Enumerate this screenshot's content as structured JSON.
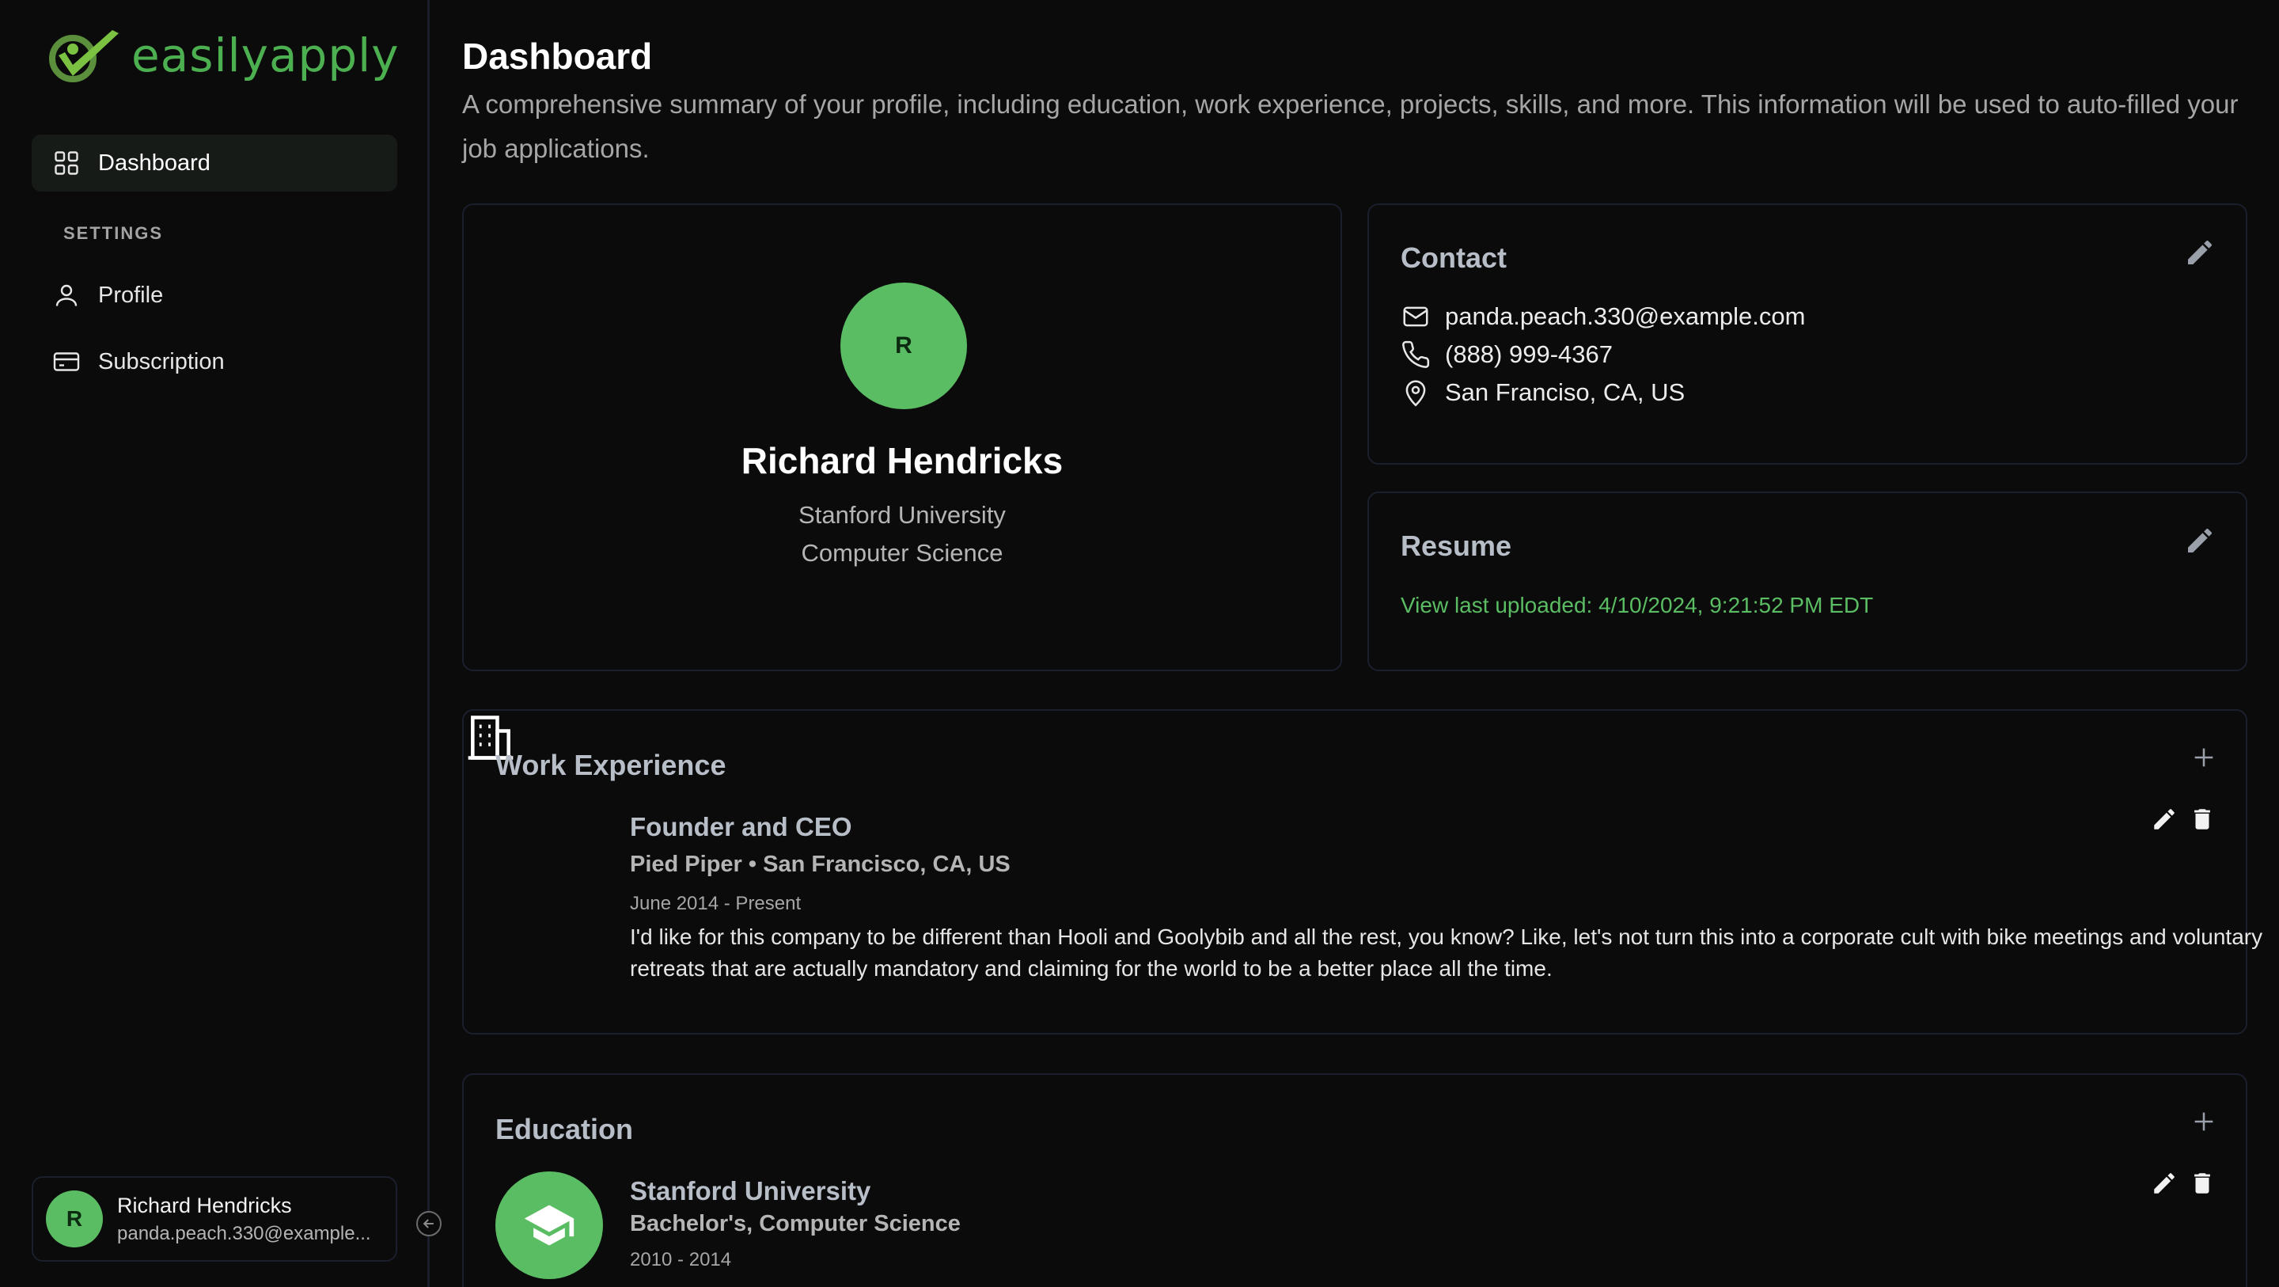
{
  "brand": {
    "name": "easilyapply",
    "accent": "#5bbd63"
  },
  "sidebar": {
    "nav": [
      {
        "label": "Dashboard",
        "icon": "dashboard-icon",
        "active": true
      }
    ],
    "settings_label": "SETTINGS",
    "settings_items": [
      {
        "label": "Profile",
        "icon": "user-icon"
      },
      {
        "label": "Subscription",
        "icon": "credit-card-icon"
      }
    ],
    "user": {
      "initial": "R",
      "name": "Richard Hendricks",
      "email": "panda.peach.330@example..."
    }
  },
  "header": {
    "title": "Dashboard",
    "description": "A comprehensive summary of your profile, including education, work experience, projects, skills, and more. This information will be used to auto-filled your job applications."
  },
  "profile": {
    "initial": "R",
    "name": "Richard Hendricks",
    "school": "Stanford University",
    "major": "Computer Science"
  },
  "contact": {
    "title": "Contact",
    "email": "panda.peach.330@example.com",
    "phone": "(888) 999-4367",
    "location": "San Franciso, CA, US"
  },
  "resume": {
    "title": "Resume",
    "link": "View last uploaded: 4/10/2024, 9:21:52 PM EDT"
  },
  "work": {
    "title": "Work Experience",
    "items": [
      {
        "title": "Founder and CEO",
        "company_line": "Pied Piper • San Francisco, CA, US",
        "dates": "June 2014 - Present",
        "description": "I'd like for this company to be different than Hooli and Goolybib and all the rest, you know? Like, let's not turn this into a corporate cult with bike meetings and voluntary retreats that are actually mandatory and claiming for the world to be a better place all the time."
      }
    ]
  },
  "education": {
    "title": "Education",
    "items": [
      {
        "school": "Stanford University",
        "degree": "Bachelor's, Computer Science",
        "dates": "2010 - 2014"
      }
    ]
  }
}
